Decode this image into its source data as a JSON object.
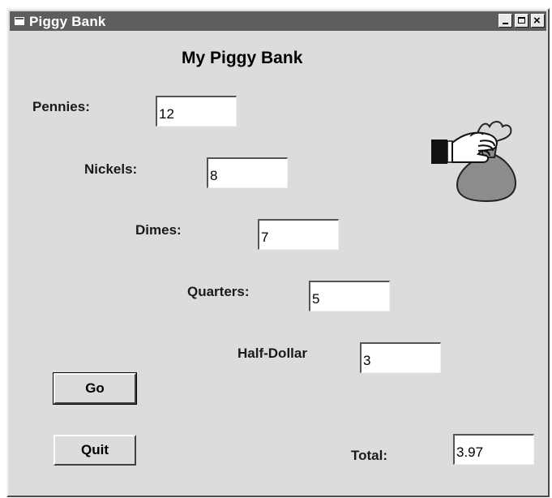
{
  "window": {
    "title": "Piggy Bank"
  },
  "form": {
    "heading": "My Piggy Bank",
    "pennies": {
      "label": "Pennies:",
      "value": "12"
    },
    "nickels": {
      "label": "Nickels:",
      "value": "8"
    },
    "dimes": {
      "label": "Dimes:",
      "value": "7"
    },
    "quarters": {
      "label": "Quarters:",
      "value": "5"
    },
    "half_dollar": {
      "label": "Half-Dollar",
      "value": "3"
    },
    "total": {
      "label": "Total:",
      "value": "3.97"
    },
    "go_label": "Go",
    "quit_label": "Quit"
  },
  "icons": {
    "window_icon": "app-window-icon",
    "picture": "money-bag-icon",
    "minimize": "minimize-icon",
    "maximize": "maximize-icon",
    "close": "close-icon"
  }
}
